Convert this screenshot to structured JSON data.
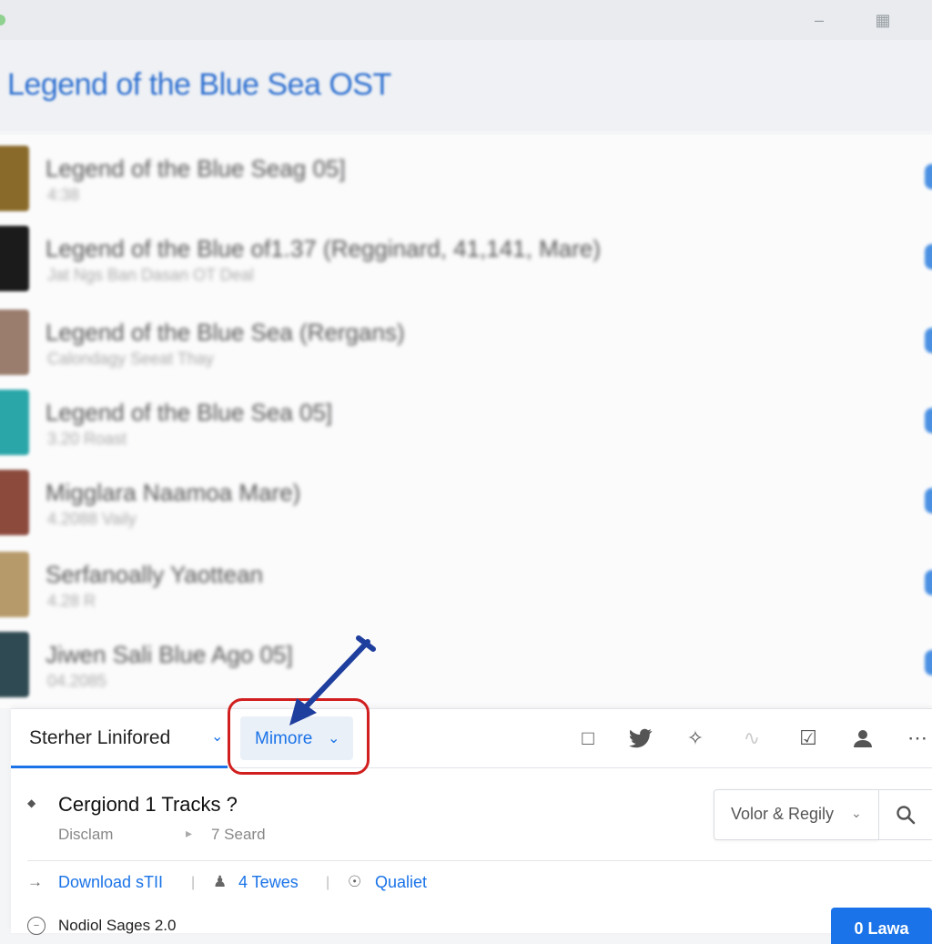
{
  "page": {
    "title": "Legend of the Blue Sea OST"
  },
  "tracks": [
    {
      "title": "Legend of the Blue Seag 05]",
      "subtitle": "4:38",
      "thumb_color": "#8a6a2a"
    },
    {
      "title": "Legend of the Blue of1.37 (Regginard, 41,141, Mare)",
      "subtitle": "Jat Ngs Ban Dasan OT Deal",
      "thumb_color": "#1b1b1b"
    },
    {
      "title": "Legend of the Blue Sea (Rergans)",
      "subtitle": "Calondagy Seeat Thay",
      "thumb_color": "#9a7d6d"
    },
    {
      "title": "Legend of the Blue Sea 05]",
      "subtitle": "3.20 Roast",
      "thumb_color": "#2aa6a8"
    },
    {
      "title": "Migglara Naamoa Mare)",
      "subtitle": "4.2088 Vaily",
      "thumb_color": "#8b4a3c"
    },
    {
      "title": "Serfanoally Yaottean",
      "subtitle": "4.28 R",
      "thumb_color": "#b79a6a"
    },
    {
      "title": "Jiwen Sali Blue Ago 05]",
      "subtitle": "04.2085",
      "thumb_color": "#2f4a52"
    }
  ],
  "panel": {
    "main_tab": "Sterher Linifored",
    "more_button": "Mimore",
    "category_title": "Cergiond 1 Tracks ?",
    "category_sub1": "Disclam",
    "category_sub2": "7 Seard",
    "sort_label": "Volor & Regily",
    "actions": {
      "download": "Download sTII",
      "tewes": "4 Tewes",
      "qualiet": "Qualiet"
    },
    "footer_text": "Nodiol Sages 2.0",
    "primary_button": "0 Lawa"
  },
  "icons": {
    "topbar": [
      "minimize-icon",
      "grid-icon"
    ],
    "toolbar": [
      "bookmark-icon",
      "twitter-icon",
      "share-icon",
      "signal-icon",
      "checkbox-icon",
      "user-icon",
      "more-icon"
    ],
    "search": "search-icon"
  },
  "colors": {
    "accent": "#1a73e8",
    "title": "#2d6fd0",
    "highlight": "#d11f1f",
    "arrow": "#1f3f9e"
  }
}
